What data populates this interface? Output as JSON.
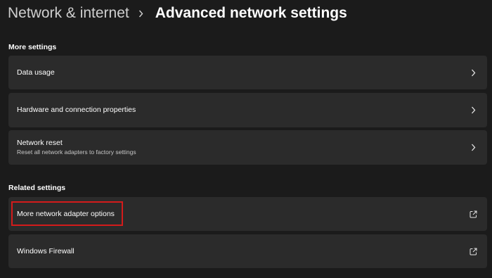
{
  "header": {
    "parent": "Network & internet",
    "current": "Advanced network settings"
  },
  "sections": {
    "more_settings": {
      "title": "More settings",
      "items": [
        {
          "label": "Data usage",
          "description": "",
          "icon": "chevron-right-icon"
        },
        {
          "label": "Hardware and connection properties",
          "description": "",
          "icon": "chevron-right-icon"
        },
        {
          "label": "Network reset",
          "description": "Reset all network adapters to factory settings",
          "icon": "chevron-right-icon"
        }
      ]
    },
    "related_settings": {
      "title": "Related settings",
      "items": [
        {
          "label": "More network adapter options",
          "description": "",
          "icon": "open-external-icon",
          "highlighted": true
        },
        {
          "label": "Windows Firewall",
          "description": "",
          "icon": "open-external-icon"
        }
      ]
    }
  },
  "colors": {
    "background": "#1b1b1b",
    "card": "#2b2b2b",
    "highlight": "#d41b1b"
  }
}
